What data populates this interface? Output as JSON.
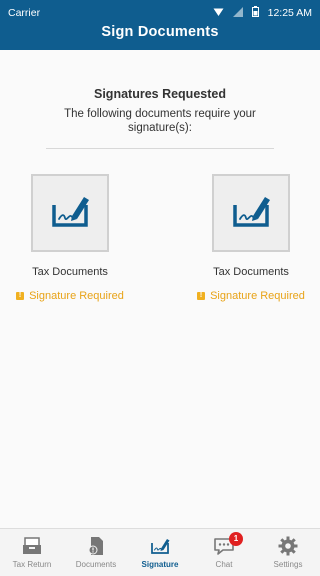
{
  "status_bar": {
    "carrier": "Carrier",
    "time": "12:25 AM"
  },
  "header": {
    "title": "Sign Documents"
  },
  "main": {
    "heading": "Signatures Requested",
    "subtext": "The following documents require your signature(s):",
    "documents": [
      {
        "name": "Tax Documents",
        "status": "Signature Required",
        "icon": "sign-document-icon"
      },
      {
        "name": "Tax Documents",
        "status": "Signature Required",
        "icon": "sign-document-icon"
      }
    ]
  },
  "tabbar": {
    "tabs": [
      {
        "label": "Tax Return",
        "icon": "tax-return-icon"
      },
      {
        "label": "Documents",
        "icon": "documents-icon"
      },
      {
        "label": "Signature",
        "icon": "signature-icon",
        "active": true
      },
      {
        "label": "Chat",
        "icon": "chat-icon",
        "badge": "1"
      },
      {
        "label": "Settings",
        "icon": "gear-icon"
      }
    ]
  },
  "colors": {
    "brand": "#0f5d8f",
    "warning": "#e8a317",
    "badge": "#e02020"
  }
}
